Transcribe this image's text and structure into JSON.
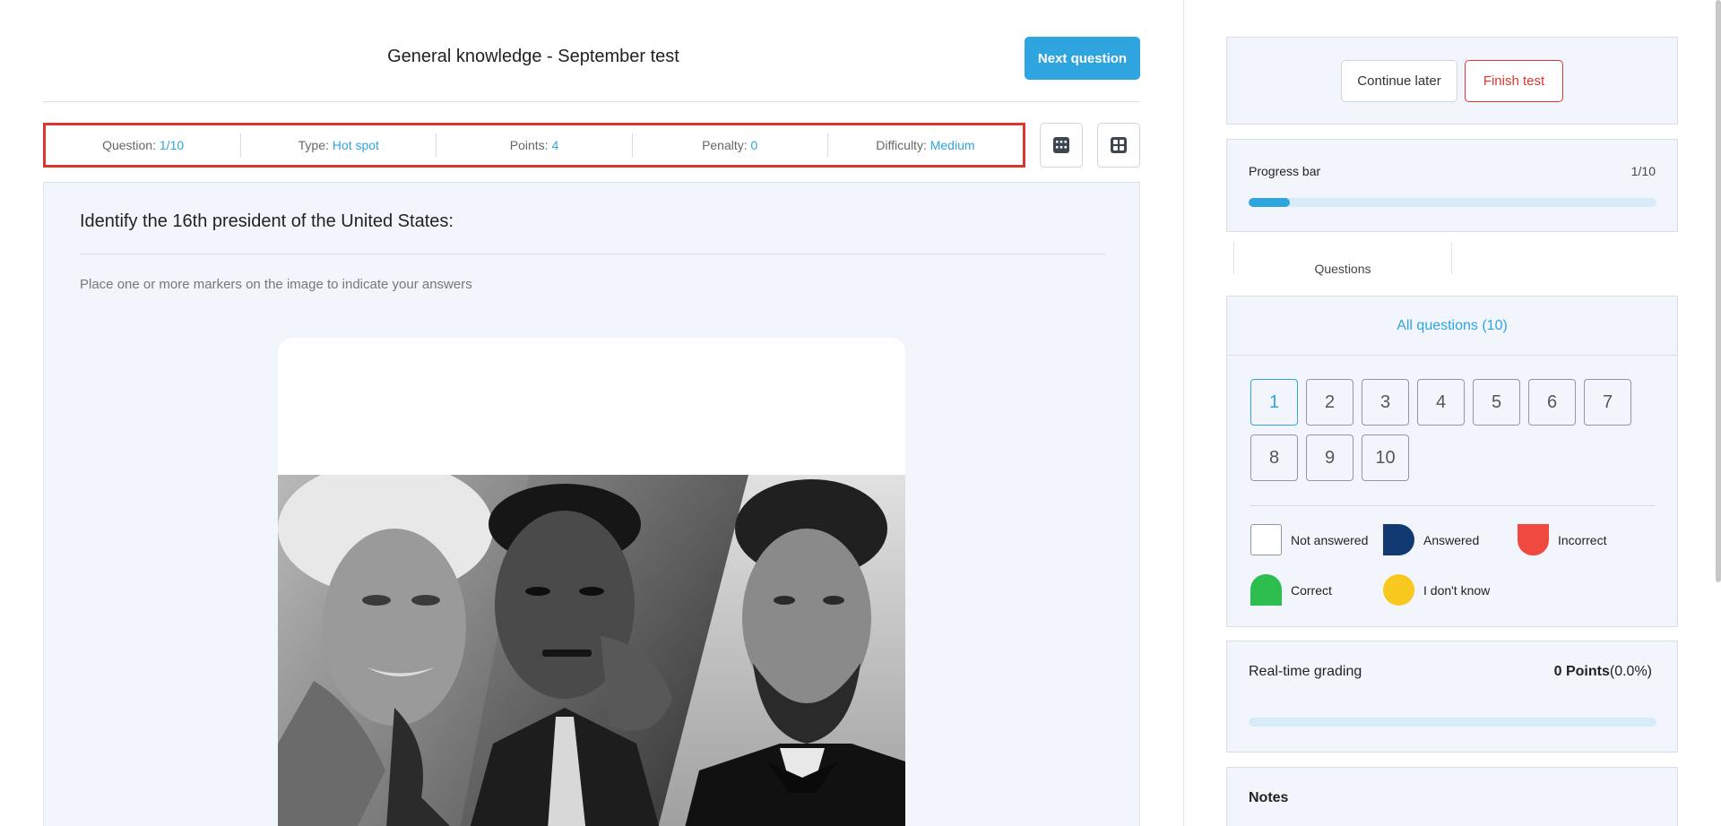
{
  "header": {
    "test_title": "General knowledge - September test",
    "next_button": "Next question"
  },
  "info_bar": {
    "question": {
      "label": "Question: ",
      "value": "1/10"
    },
    "type": {
      "label": "Type: ",
      "value": "Hot spot"
    },
    "points": {
      "label": "Points: ",
      "value": "4"
    },
    "penalty": {
      "label": "Penalty: ",
      "value": "0"
    },
    "difficulty": {
      "label": "Difficulty: ",
      "value": "Medium"
    }
  },
  "icons": {
    "calculator": "calculator-icon",
    "grid": "grid-icon"
  },
  "question": {
    "text": "Identify the 16th president of the United States:",
    "instruction": "Place one or more markers on the image to indicate your answers"
  },
  "sidebar": {
    "continue_button": "Continue later",
    "finish_button": "Finish test",
    "progress": {
      "label": "Progress bar",
      "count": "1/10",
      "fraction": 0.1
    },
    "questions_tab": "Questions",
    "all_questions": "All questions (10)",
    "question_numbers": [
      "1",
      "2",
      "3",
      "4",
      "5",
      "6",
      "7",
      "8",
      "9",
      "10"
    ],
    "active_question": "1",
    "legend": {
      "not_answered": "Not answered",
      "answered": "Answered",
      "incorrect": "Incorrect",
      "correct": "Correct",
      "dont_know": "I don't know"
    },
    "grading": {
      "label": "Real-time grading",
      "points": "0 Points",
      "percent": "(0.0%)"
    },
    "notes": "Notes"
  },
  "colors": {
    "accent": "#2ea5df",
    "danger": "#e0342e",
    "answered": "#123a72",
    "incorrect": "#f04a40",
    "correct": "#2ebd4f",
    "dont_know": "#f8c81e"
  }
}
